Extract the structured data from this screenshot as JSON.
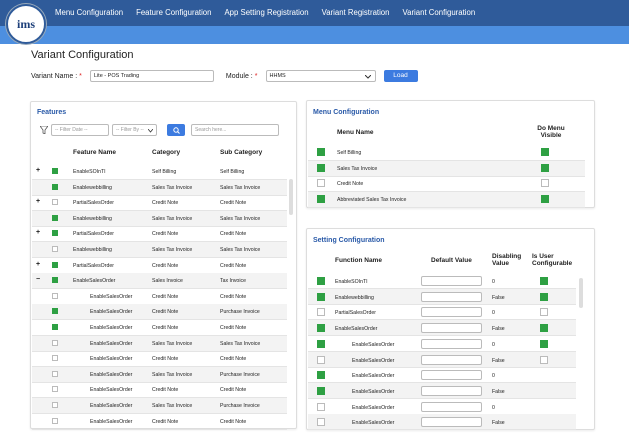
{
  "brand": {
    "logo_text": "ims"
  },
  "nav": [
    "Menu Configuration",
    "Feature Configuration",
    "App Setting Registration",
    "Variant Registration",
    "Variant Configuration"
  ],
  "page_title": "Variant  Configuration",
  "variant": {
    "label": "Variant Name  :",
    "value": "Lite - POS Trading",
    "module_label": "Module  :",
    "module_value": "HHMS",
    "load": "Load"
  },
  "features": {
    "title": "Features",
    "filter_date": "-- Filter Date --",
    "filter_by": "-- Filter By --",
    "search_placeholder": "Search here...",
    "headers": [
      "Feature Name",
      "Category",
      "Sub Category"
    ],
    "rows": [
      {
        "exp": "+",
        "on": true,
        "name": "EnableSOInTI",
        "cat": "Self Billing",
        "sub": "Self Billing",
        "indent": false
      },
      {
        "exp": "",
        "on": true,
        "name": "Enablewebbilling",
        "cat": "Sales Tax Invoice",
        "sub": "Sales Tax Invoice",
        "indent": false
      },
      {
        "exp": "+",
        "on": false,
        "name": "PartialSalesOrder",
        "cat": "Credit Note",
        "sub": "Credit Note",
        "indent": false
      },
      {
        "exp": "",
        "on": true,
        "name": "Enablewebbilling",
        "cat": "Sales Tax Invoice",
        "sub": "Sales Tax Invoice",
        "indent": false
      },
      {
        "exp": "+",
        "on": true,
        "name": "PartialSalesOrder",
        "cat": "Credit Note",
        "sub": "Credit Note",
        "indent": false
      },
      {
        "exp": "",
        "on": false,
        "name": "Enablewebbilling",
        "cat": "Sales Tax Invoice",
        "sub": "Sales Tax Invoice",
        "indent": false
      },
      {
        "exp": "+",
        "on": true,
        "name": "PartialSalesOrder",
        "cat": "Credit Note",
        "sub": "Credit Note",
        "indent": false
      },
      {
        "exp": "−",
        "on": true,
        "name": "EnableSalesOrder",
        "cat": "Sales Invoice",
        "sub": "Tax Invoice",
        "indent": false
      },
      {
        "exp": "",
        "on": false,
        "name": "EnableSalesOrder",
        "cat": "Credit Note",
        "sub": "Credit Note",
        "indent": true
      },
      {
        "exp": "",
        "on": true,
        "name": "EnableSalesOrder",
        "cat": "Credit Note",
        "sub": "Purchase Invoice",
        "indent": true
      },
      {
        "exp": "",
        "on": true,
        "name": "EnableSalesOrder",
        "cat": "Credit Note",
        "sub": "Credit Note",
        "indent": true
      },
      {
        "exp": "",
        "on": false,
        "name": "EnableSalesOrder",
        "cat": "Sales Tax Invoice",
        "sub": "Sales Tax Invoice",
        "indent": true
      },
      {
        "exp": "",
        "on": false,
        "name": "EnableSalesOrder",
        "cat": "Credit Note",
        "sub": "Credit Note",
        "indent": true
      },
      {
        "exp": "",
        "on": false,
        "name": "EnableSalesOrder",
        "cat": "Sales Tax Invoice",
        "sub": "Purchase Invoice",
        "indent": true
      },
      {
        "exp": "",
        "on": false,
        "name": "EnableSalesOrder",
        "cat": "Credit Note",
        "sub": "Credit Note",
        "indent": true
      },
      {
        "exp": "",
        "on": false,
        "name": "EnableSalesOrder",
        "cat": "Sales Tax Invoice",
        "sub": "Purchase Invoice",
        "indent": true
      },
      {
        "exp": "",
        "on": false,
        "name": "EnableSalesOrder",
        "cat": "Credit Note",
        "sub": "Credit Note",
        "indent": true
      }
    ]
  },
  "menu": {
    "title": "Menu Configuration",
    "headers": [
      "Menu Name",
      "Do Menu Visible"
    ],
    "rows": [
      {
        "on": true,
        "name": "Self Billing",
        "vis": true
      },
      {
        "on": true,
        "name": "Sales Tax Invoice",
        "vis": true
      },
      {
        "on": false,
        "name": "Credit Note",
        "vis": false
      },
      {
        "on": true,
        "name": "Abbreviated Sales Tax Invoice",
        "vis": true
      }
    ]
  },
  "setting": {
    "title": "Setting Configuration",
    "headers": [
      "Function Name",
      "Default Value",
      "Disabling Value",
      "Is User Configurable"
    ],
    "rows": [
      {
        "on": true,
        "name": "EnableSOInTI",
        "dis": "0",
        "uc": true,
        "indent": false
      },
      {
        "on": true,
        "name": "Enablewebbilling",
        "dis": "False",
        "uc": true,
        "indent": false
      },
      {
        "on": false,
        "name": "PartialSalesOrder",
        "dis": "0",
        "uc": false,
        "indent": false
      },
      {
        "on": true,
        "name": "EnableSalesOrder",
        "dis": "False",
        "uc": true,
        "indent": false
      },
      {
        "on": true,
        "name": "EnableSalesOrder",
        "dis": "0",
        "uc": true,
        "indent": true
      },
      {
        "on": false,
        "name": "EnableSalesOrder",
        "dis": "False",
        "uc": false,
        "indent": true
      },
      {
        "on": true,
        "name": "EnableSalesOrder",
        "dis": "0",
        "uc": null,
        "indent": true
      },
      {
        "on": true,
        "name": "EnableSalesOrder",
        "dis": "False",
        "uc": null,
        "indent": true
      },
      {
        "on": false,
        "name": "EnableSalesOrder",
        "dis": "0",
        "uc": null,
        "indent": true
      },
      {
        "on": false,
        "name": "EnableSalesOrder",
        "dis": "False",
        "uc": null,
        "indent": true
      }
    ]
  },
  "colors": {
    "nav": "#2f5b9a",
    "strip": "#4d8fe0",
    "accent": "#3c7be0",
    "check": "#2ea043"
  }
}
